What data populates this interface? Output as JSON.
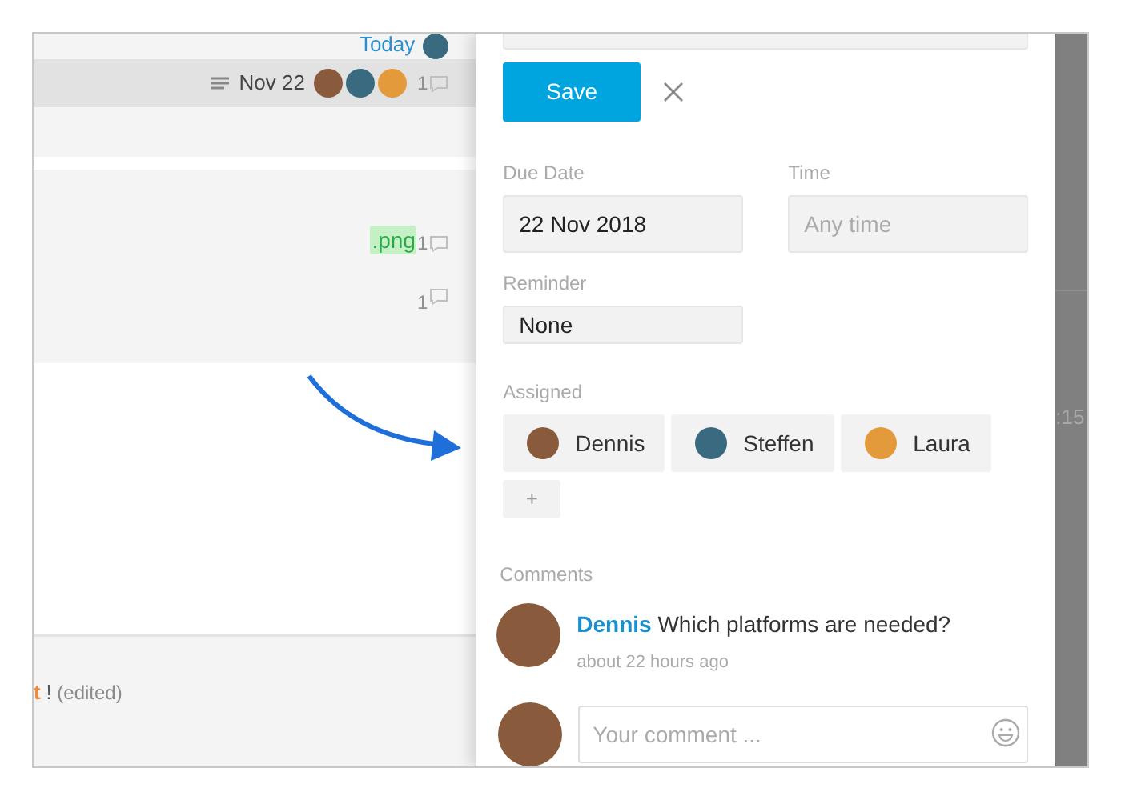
{
  "task_list": {
    "rows": [
      {
        "kind": "dated",
        "selected": false,
        "date": "Today"
      },
      {
        "kind": "task",
        "selected": true,
        "date": "Nov 22",
        "comment_count": "1"
      },
      {
        "kind": "blank",
        "selected": false
      },
      {
        "kind": "attachment",
        "selected": false,
        "tag": ".png",
        "comment_count": "1"
      },
      {
        "kind": "comment",
        "selected": false,
        "comment_count": "1"
      }
    ]
  },
  "footer_message": {
    "highlight": "t",
    "punctuation": "!",
    "note": "(edited)"
  },
  "side_strip": {
    "text": ":15"
  },
  "panel": {
    "save_button": "Save",
    "due_date": {
      "label": "Due Date",
      "value": "22 Nov 2018"
    },
    "time": {
      "label": "Time",
      "placeholder": "Any time"
    },
    "reminder": {
      "label": "Reminder",
      "value": "None"
    },
    "assigned": {
      "label": "Assigned",
      "people": [
        "Dennis",
        "Steffen",
        "Laura"
      ],
      "add": "+"
    },
    "comments": {
      "label": "Comments",
      "items": [
        {
          "author": "Dennis",
          "text": "Which platforms are needed?",
          "time": "about 22 hours ago"
        }
      ]
    },
    "comment_input": {
      "placeholder": "Your comment ..."
    }
  }
}
